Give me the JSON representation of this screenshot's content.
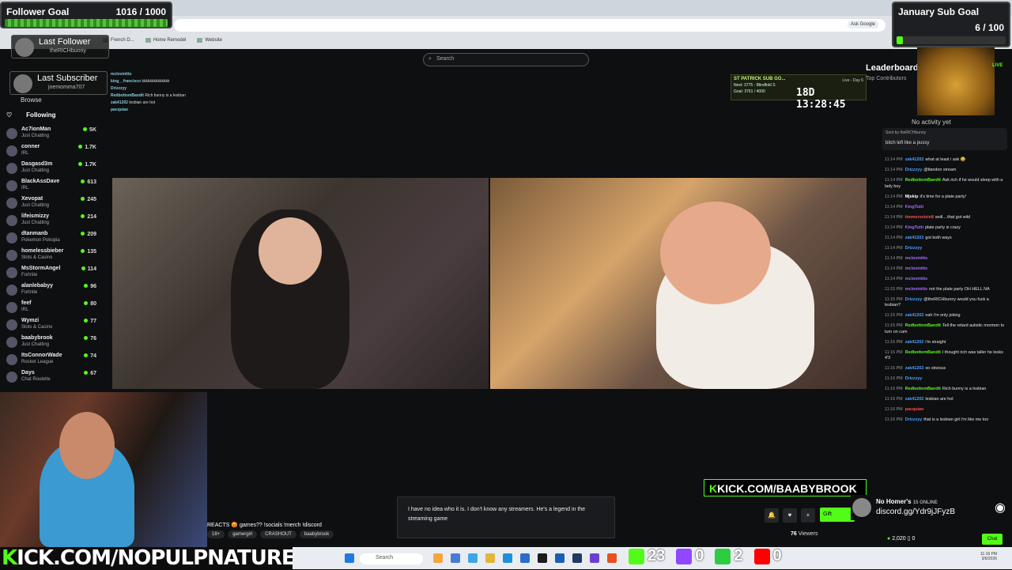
{
  "browser": {
    "bookmarks": [
      "French D...",
      "Home Remodel",
      "Website"
    ],
    "ask_google": "Ask Google"
  },
  "follower_goal": {
    "title": "Follower Goal",
    "value": "1016 / 1000",
    "progress": 1.0,
    "color": "#53fc18"
  },
  "sub_goal": {
    "title": "January Sub Goal",
    "value": "6 / 100",
    "progress": 0.06
  },
  "last_follower": {
    "label": "Last Follower",
    "name": "theRICHbunny"
  },
  "last_subscriber": {
    "label": "Last Subscriber",
    "name": "joemomma707"
  },
  "sidebar": {
    "browse": "Browse",
    "following": "Following",
    "channels": [
      {
        "name": "Ac7ionMan",
        "category": "Just Chatting",
        "viewers": "5K"
      },
      {
        "name": "conner",
        "category": "IRL",
        "viewers": "1.7K"
      },
      {
        "name": "Dasgasd3m",
        "category": "Just Chatting",
        "viewers": "1.7K"
      },
      {
        "name": "BlackAssDave",
        "category": "IRL",
        "viewers": "613"
      },
      {
        "name": "Xevopat",
        "category": "Just Chatting",
        "viewers": "245"
      },
      {
        "name": "lifeismizzy",
        "category": "Just Chatting",
        "viewers": "214"
      },
      {
        "name": "dtanmanb",
        "category": "Pokemon Pokopia",
        "viewers": "209"
      },
      {
        "name": "homelessbieber",
        "category": "Slots & Casino",
        "viewers": "135"
      },
      {
        "name": "MsStormAngel",
        "category": "Fortnite",
        "viewers": "114"
      },
      {
        "name": "alanlebabyy",
        "category": "Fortnite",
        "viewers": "96"
      },
      {
        "name": "feef",
        "category": "IRL",
        "viewers": "80"
      },
      {
        "name": "Wymzi",
        "category": "Slots & Casino",
        "viewers": "77"
      },
      {
        "name": "baabybrook",
        "category": "Just Chatting",
        "viewers": "76"
      },
      {
        "name": "ItsConnorWade",
        "category": "Rocket League",
        "viewers": "74"
      },
      {
        "name": "Days",
        "category": "Chat Roulette",
        "viewers": "67"
      }
    ]
  },
  "search": {
    "placeholder": "Search"
  },
  "overlay_chat": [
    {
      "user": "mclovintits",
      "msg": ""
    },
    {
      "user": "king__francisco",
      "msg": "kkkkkkkkkkkkkk"
    },
    {
      "user": "Drizzzyy",
      "msg": ""
    },
    {
      "user": "RedbottomBandit",
      "msg": "Rich bunny is a lesbian"
    },
    {
      "user": "zak41202",
      "msg": "lesbian are hot"
    },
    {
      "user": "pacquiao",
      "msg": ""
    }
  ],
  "sub_goal_widget": {
    "title": "ST PATRICK SUB GO...",
    "line1": "Next: 3775 - Blindfold S",
    "line2": "Goal: 3761 / 4000",
    "timer": "18D 13:28:45",
    "tag": "Live - Day 6"
  },
  "kick_banner": {
    "k": "K",
    "text": "KICK.COM/BAABYBROOK"
  },
  "caption": "I have no idea who it is. I don't know any streamers. He's a legend in the streaming game",
  "stream_title": "REACTS 😡 games?? !socials !merch !discord",
  "tags": [
    "18+",
    "gamergirl",
    "CRASHOUT",
    "baabybrook"
  ],
  "webcam_banner": {
    "k": "K",
    "text": "ICK.COM/NOPULPNATURE"
  },
  "right_panel": {
    "leaderboard": "Leaderboard",
    "top_contributors": "Top Contributors",
    "no_activity": "No activity yet",
    "live": "LIVE",
    "pinned_by": "Sent by theRICHbunny",
    "pinned_msg": "bitch left like a pussy"
  },
  "chat": [
    {
      "time": "11:14 PM",
      "user": "zak41202",
      "color": "#4aa0ff",
      "msg": "what at least i ask 😂"
    },
    {
      "time": "11:14 PM",
      "user": "Drizzzyy",
      "color": "#4aa0ff",
      "msg": "@tlandon stream"
    },
    {
      "time": "11:14 PM",
      "user": "RedbottomBandit",
      "color": "#53fc18",
      "msg": "Ask rich if he would sleep with a lady boy"
    },
    {
      "time": "11:14 PM",
      "user": "Mjskip",
      "color": "#ffffff",
      "msg": "it's time for a plate party!"
    },
    {
      "time": "11:14 PM",
      "user": "KingTutti",
      "color": "#a66bff",
      "msg": ""
    },
    {
      "time": "11:14 PM",
      "user": "timmersvisin8",
      "color": "#ff4d4d",
      "msg": "woll....that got wild"
    },
    {
      "time": "11:14 PM",
      "user": "KingTutti",
      "color": "#a66bff",
      "msg": "plate party is crazy"
    },
    {
      "time": "11:14 PM",
      "user": "zak41202",
      "color": "#4aa0ff",
      "msg": "got both ways"
    },
    {
      "time": "11:14 PM",
      "user": "Drizzzyy",
      "color": "#4aa0ff",
      "msg": ""
    },
    {
      "time": "11:14 PM",
      "user": "mclovintits",
      "color": "#a66bff",
      "msg": ""
    },
    {
      "time": "11:14 PM",
      "user": "mclovintits",
      "color": "#a66bff",
      "msg": ""
    },
    {
      "time": "11:14 PM",
      "user": "mclovintits",
      "color": "#a66bff",
      "msg": ""
    },
    {
      "time": "11:15 PM",
      "user": "mclovintits",
      "color": "#a66bff",
      "msg": "not the plate party OH HELL NA"
    },
    {
      "time": "11:15 PM",
      "user": "Drizzzyy",
      "color": "#4aa0ff",
      "msg": "@theRICHbunny would you fuck a lesbian?"
    },
    {
      "time": "11:15 PM",
      "user": "zak41202",
      "color": "#4aa0ff",
      "msg": "nah i'm only joking"
    },
    {
      "time": "11:15 PM",
      "user": "RedbottomBandit",
      "color": "#53fc18",
      "msg": "Tell the retard autistic mormon to turn on cam"
    },
    {
      "time": "11:15 PM",
      "user": "zak41202",
      "color": "#4aa0ff",
      "msg": "i'm straight"
    },
    {
      "time": "11:16 PM",
      "user": "RedbottomBandit",
      "color": "#53fc18",
      "msg": "I thought rich was taller he looks 4'3"
    },
    {
      "time": "11:16 PM",
      "user": "zak41202",
      "color": "#4aa0ff",
      "msg": "so obvious"
    },
    {
      "time": "11:16 PM",
      "user": "Drizzzyy",
      "color": "#4aa0ff",
      "msg": ""
    },
    {
      "time": "11:16 PM",
      "user": "RedbottomBandit",
      "color": "#53fc18",
      "msg": "Rich bunny is a lesbian"
    },
    {
      "time": "11:16 PM",
      "user": "zak41202",
      "color": "#4aa0ff",
      "msg": "lesbian are hot"
    },
    {
      "time": "11:16 PM",
      "user": "pacquiao",
      "color": "#ff4d4d",
      "msg": ""
    },
    {
      "time": "11:16 PM",
      "user": "Drizzzyy",
      "color": "#4aa0ff",
      "msg": "that is a lesbian girl i'm like me too"
    }
  ],
  "discord": {
    "name": "No Homer's",
    "status": "15 ONLINE",
    "link": "discord.gg/Ydr9jJFyzB"
  },
  "footer": {
    "viewers": "76",
    "viewers_label": "Viewers",
    "gift": "Gift",
    "kicks": "2,020",
    "points": "0",
    "chat_btn": "Chat"
  },
  "taskbar": {
    "search": "Search",
    "time": "11:16 PM",
    "date": "3/6/2026"
  },
  "counters": [
    {
      "icon": "kick-icon",
      "color": "#53fc18",
      "value": "23"
    },
    {
      "icon": "twitch-icon",
      "color": "#9146ff",
      "value": "0"
    },
    {
      "icon": "clover-icon",
      "color": "#2ecc40",
      "value": "2"
    },
    {
      "icon": "youtube-icon",
      "color": "#ff0000",
      "value": "0"
    }
  ]
}
